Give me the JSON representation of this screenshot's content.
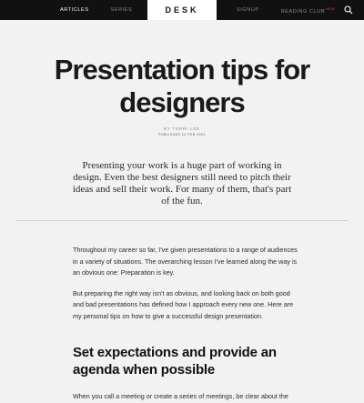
{
  "nav": {
    "left": [
      "ARTICLES",
      "SERIES"
    ],
    "logo": "DESK",
    "right": [
      "SIGNUP",
      "READING CLUB"
    ],
    "reading_club_badge": "NEW",
    "search_icon": "search-icon"
  },
  "article": {
    "title": "Presentation tips for designers",
    "byline_prefix": "BY ",
    "author": "TERRI LEE",
    "published": "PUBLISHED 19 FEB 2021",
    "intro": "Presenting your work is a huge part of working in design. Even the best designers still need to pitch their ideas and sell their work. For many of them, that's part of the fun.",
    "paragraphs": [
      "Throughout my career so far, I've given presentations to a range of audiences in a variety of situations. The overarching lesson I've learned along the way is an obvious one: Preparation is key.",
      "But preparing the right way isn't as obvious, and looking back on both good and bad presentations has defined how I approach every new one. Here are my personal tips on how to give a successful design presentation."
    ],
    "heading": "Set expectations and provide an agenda when possible",
    "next_paragraph": "When you call a meeting or create a series of meetings, be clear about the"
  },
  "colors": {
    "topbar": "#111111",
    "background": "#f2f2f2",
    "badge": "#e0413b"
  }
}
